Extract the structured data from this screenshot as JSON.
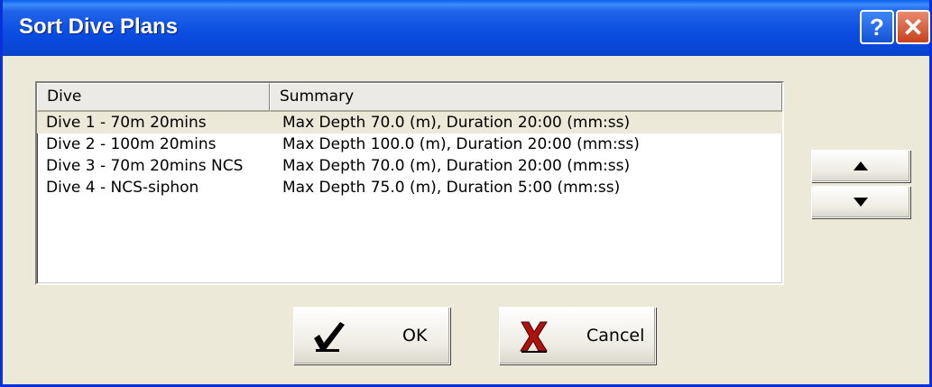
{
  "window": {
    "title": "Sort Dive Plans"
  },
  "titlebar": {
    "help_label": "?",
    "close_label": "✕"
  },
  "list": {
    "columns": [
      "Dive",
      "Summary"
    ],
    "rows": [
      {
        "dive": "Dive 1 - 70m 20mins",
        "summary": "Max Depth 70.0 (m), Duration 20:00 (mm:ss)",
        "selected": true
      },
      {
        "dive": "Dive 2 - 100m 20mins",
        "summary": "Max Depth 100.0 (m), Duration 20:00 (mm:ss)",
        "selected": false
      },
      {
        "dive": "Dive 3 - 70m 20mins NCS",
        "summary": "Max Depth 70.0 (m), Duration 20:00 (mm:ss)",
        "selected": false
      },
      {
        "dive": "Dive 4 - NCS-siphon",
        "summary": "Max Depth 75.0 (m), Duration 5:00 (mm:ss)",
        "selected": false
      }
    ]
  },
  "buttons": {
    "ok_label": "OK",
    "cancel_label": "Cancel"
  },
  "icons": {
    "up": "triangle-up-icon",
    "down": "triangle-down-icon",
    "ok": "checkmark-icon",
    "cancel": "red-x-icon"
  },
  "colors": {
    "titlebar": "#0A4DE0",
    "dialog_bg": "#ECE9D8",
    "cancel_icon": "#B01010",
    "selected_row": "#ECE9D8"
  }
}
